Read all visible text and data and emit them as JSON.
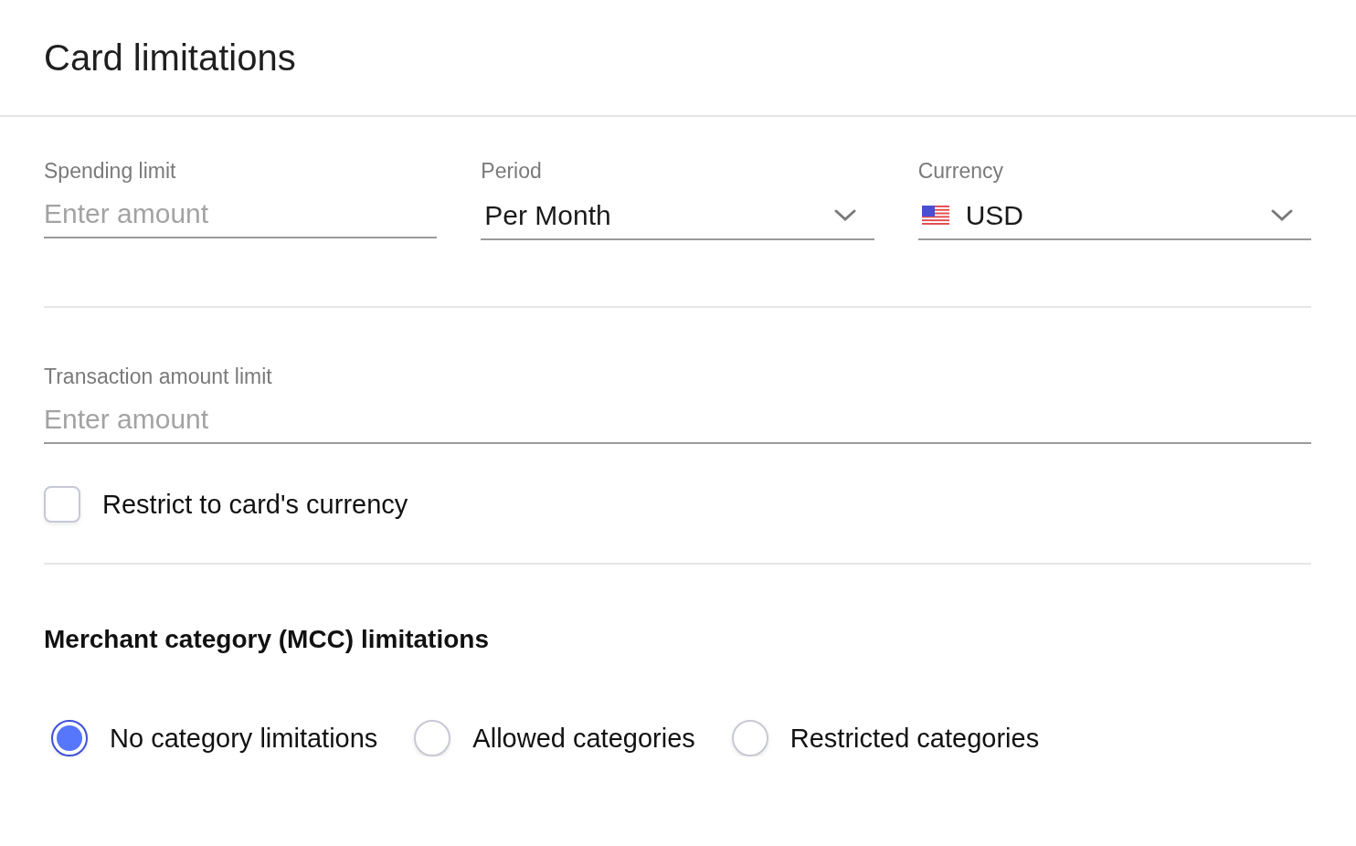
{
  "header": {
    "title": "Card limitations"
  },
  "limit_fields": [
    {
      "kind": "input",
      "label": "Spending limit",
      "placeholder": "Enter amount"
    },
    {
      "kind": "select",
      "label": "Period",
      "value": "Per Month"
    },
    {
      "kind": "currency",
      "label": "Currency",
      "value": "USD"
    }
  ],
  "transaction_field": {
    "label": "Transaction amount limit",
    "placeholder": "Enter amount"
  },
  "restrict_checkbox": {
    "label": "Restrict to card's currency",
    "checked": false
  },
  "mcc": {
    "heading": "Merchant category (MCC) limitations",
    "options": [
      {
        "label": "No category limitations",
        "selected": true
      },
      {
        "label": "Allowed categories",
        "selected": false
      },
      {
        "label": "Restricted categories",
        "selected": false
      }
    ]
  }
}
